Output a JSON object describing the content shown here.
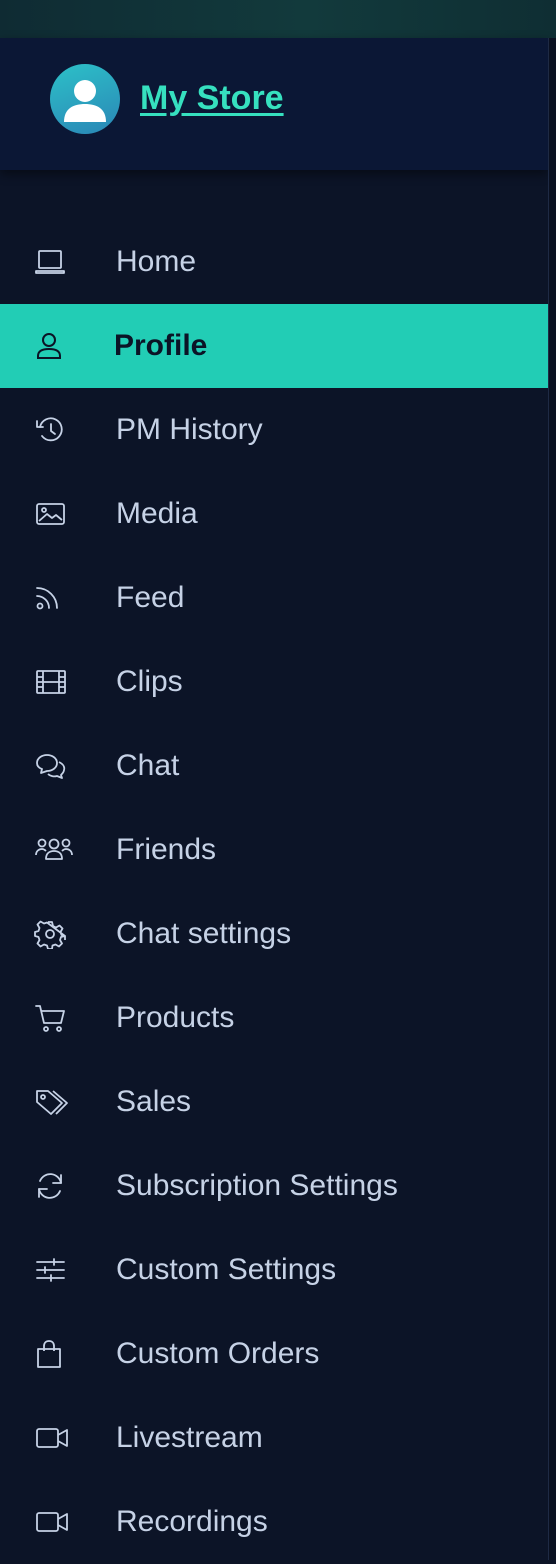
{
  "store": {
    "name": "My Store"
  },
  "colors": {
    "accent": "#22cdb5",
    "link": "#36e0bf",
    "sidebar_bg": "#0c1427",
    "header_bg": "#0b1735",
    "text": "#c6d2e6"
  },
  "nav": {
    "active_index": 1,
    "items": [
      {
        "label": "Home",
        "icon": "laptop-icon"
      },
      {
        "label": "Profile",
        "icon": "user-icon"
      },
      {
        "label": "PM History",
        "icon": "history-icon"
      },
      {
        "label": "Media",
        "icon": "image-icon"
      },
      {
        "label": "Feed",
        "icon": "rss-icon"
      },
      {
        "label": "Clips",
        "icon": "film-icon"
      },
      {
        "label": "Chat",
        "icon": "chat-bubbles-icon"
      },
      {
        "label": "Friends",
        "icon": "users-icon"
      },
      {
        "label": "Chat settings",
        "icon": "gear-icon"
      },
      {
        "label": "Products",
        "icon": "cart-icon"
      },
      {
        "label": "Sales",
        "icon": "tags-icon"
      },
      {
        "label": "Subscription Settings",
        "icon": "refresh-icon"
      },
      {
        "label": "Custom Settings",
        "icon": "sliders-icon"
      },
      {
        "label": "Custom Orders",
        "icon": "shopping-bag-icon"
      },
      {
        "label": "Livestream",
        "icon": "video-camera-icon"
      },
      {
        "label": "Recordings",
        "icon": "video-camera-icon"
      }
    ]
  }
}
